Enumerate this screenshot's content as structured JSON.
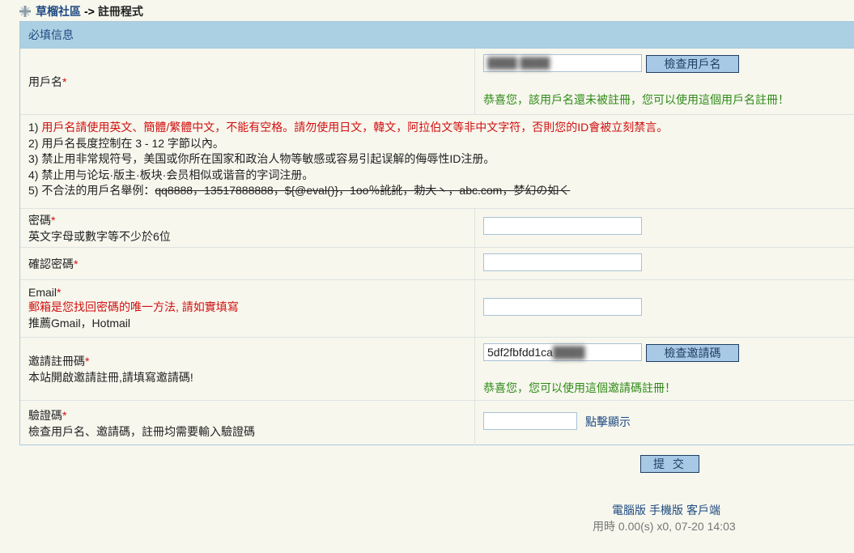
{
  "breadcrumb": {
    "home": "草榴社區",
    "separator": "->",
    "current": "註冊程式"
  },
  "section": {
    "title": "必填信息"
  },
  "username": {
    "label": "用戶名",
    "required_mark": "*",
    "value": "████ ████",
    "check_button": "檢查用戶名",
    "success": "恭喜您，該用戶名還未被註冊，您可以使用這個用戶名註冊！"
  },
  "rules": {
    "items": [
      {
        "num": "1)",
        "text": "用戶名請使用英文、簡體/繁體中文，不能有空格。請勿使用日文，韓文，阿拉伯文等非中文字符，否則您的ID會被立刻禁言。"
      },
      {
        "num": "2)",
        "text": "用戶名長度控制在 3 - 12 字節以內。"
      },
      {
        "num": "3)",
        "text": "禁止用非常规符号，美国或你所在国家和政治人物等敏感或容易引起误解的侮辱性ID注册。"
      },
      {
        "num": "4)",
        "text": "禁止用与论坛·版主·板块·会员相似或谐音的字词注册。"
      }
    ],
    "item5_prefix": "5) 不合法的用戶名舉例：",
    "item5_examples": "qq8888，13517888888，${@eval()}，1oo％訛訛，勅大丶，abc.com，梦幻の如く"
  },
  "password": {
    "label": "密碼",
    "required_mark": "*",
    "hint": "英文字母或數字等不少於6位"
  },
  "confirm_password": {
    "label": "確認密碼",
    "required_mark": "*"
  },
  "email": {
    "label": "Email",
    "required_mark": "*",
    "warning": "郵箱是您找回密碼的唯一方法, 請如實填寫",
    "hint": "推薦Gmail，Hotmail"
  },
  "invite": {
    "label": "邀請註冊碼",
    "required_mark": "*",
    "hint": "本站開啟邀請註冊,請填寫邀請碼!",
    "value_visible": "5df2fbfdd1ca",
    "value_hidden": "████",
    "check_button": "檢查邀請碼",
    "success": "恭喜您，您可以使用這個邀請碼註冊！"
  },
  "captcha": {
    "label": "驗證碼",
    "required_mark": "*",
    "hint": "檢查用戶名、邀請碼，註冊均需要輸入驗證碼",
    "show_link": "點擊顯示"
  },
  "submit": {
    "label": "提 交"
  },
  "footer": {
    "link_pc": "電腦版",
    "link_mobile": "手機版",
    "link_client": "客戶端",
    "stats": "用時 0.00(s) x0, 07-20 14:03"
  },
  "colors": {
    "header_bg": "#acd0e3",
    "link": "#1f4a80",
    "error": "#d01010",
    "success": "#2f8a17",
    "page_bg": "#f7f7ee"
  }
}
